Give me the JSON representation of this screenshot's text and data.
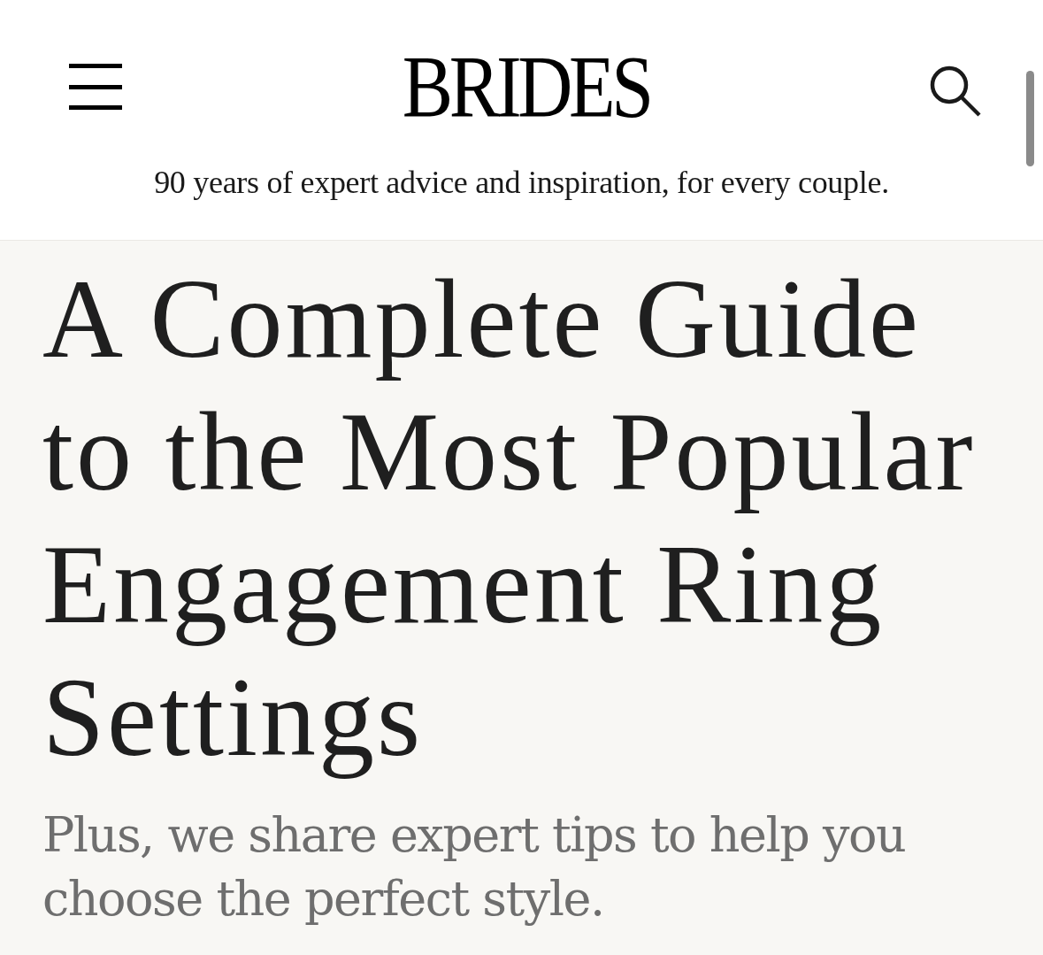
{
  "header": {
    "logo": "BRIDES",
    "tagline": "90 years of expert advice and inspiration, for every couple."
  },
  "article": {
    "title": "A Complete Guide to the Most Popular Engagement Ring Settings",
    "subtitle": "Plus, we share expert tips to help you choose the perfect style."
  }
}
